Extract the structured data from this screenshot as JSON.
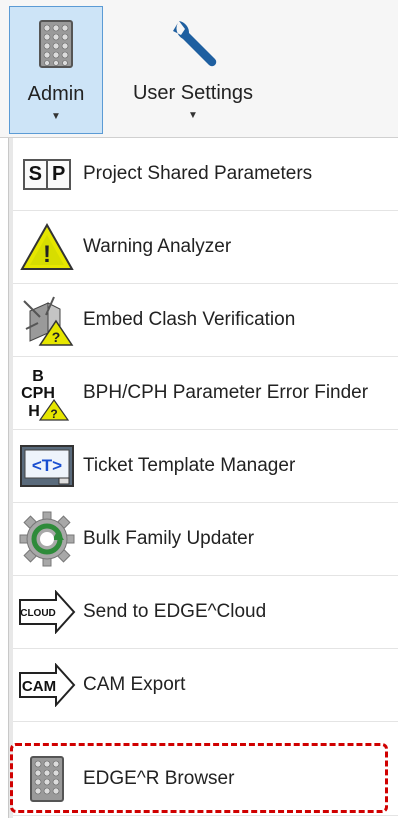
{
  "ribbon": {
    "admin_label": "Admin",
    "user_settings_label": "User Settings"
  },
  "menu": {
    "items": [
      {
        "label": "Project Shared Parameters",
        "icon": "sp-grid-icon"
      },
      {
        "label": "Warning Analyzer",
        "icon": "warning-triangle-icon"
      },
      {
        "label": "Embed Clash Verification",
        "icon": "embed-clash-icon"
      },
      {
        "label": "BPH/CPH Parameter Error Finder",
        "icon": "bph-cph-icon"
      },
      {
        "label": "Ticket Template Manager",
        "icon": "ticket-template-icon"
      },
      {
        "label": "Bulk Family Updater",
        "icon": "gear-refresh-icon"
      },
      {
        "label": "Send to EDGE^Cloud",
        "icon": "cloud-arrow-icon"
      },
      {
        "label": "CAM Export",
        "icon": "cam-arrow-icon"
      },
      {
        "label": "EDGE^R Browser",
        "icon": "edge-grid-icon"
      }
    ],
    "sp_letters": [
      "S",
      "P"
    ],
    "bph_letters": {
      "b": "B",
      "cph": "CPH",
      "h": "H",
      "q": "?"
    },
    "ticket_glyph": "<T>",
    "cloud_tag": "CLOUD",
    "cam_tag": "CAM",
    "warning_glyph": "!"
  },
  "colors": {
    "highlight": "#d00000",
    "selected_bg": "#cde4f7",
    "warning_yellow": "#e6e600"
  }
}
